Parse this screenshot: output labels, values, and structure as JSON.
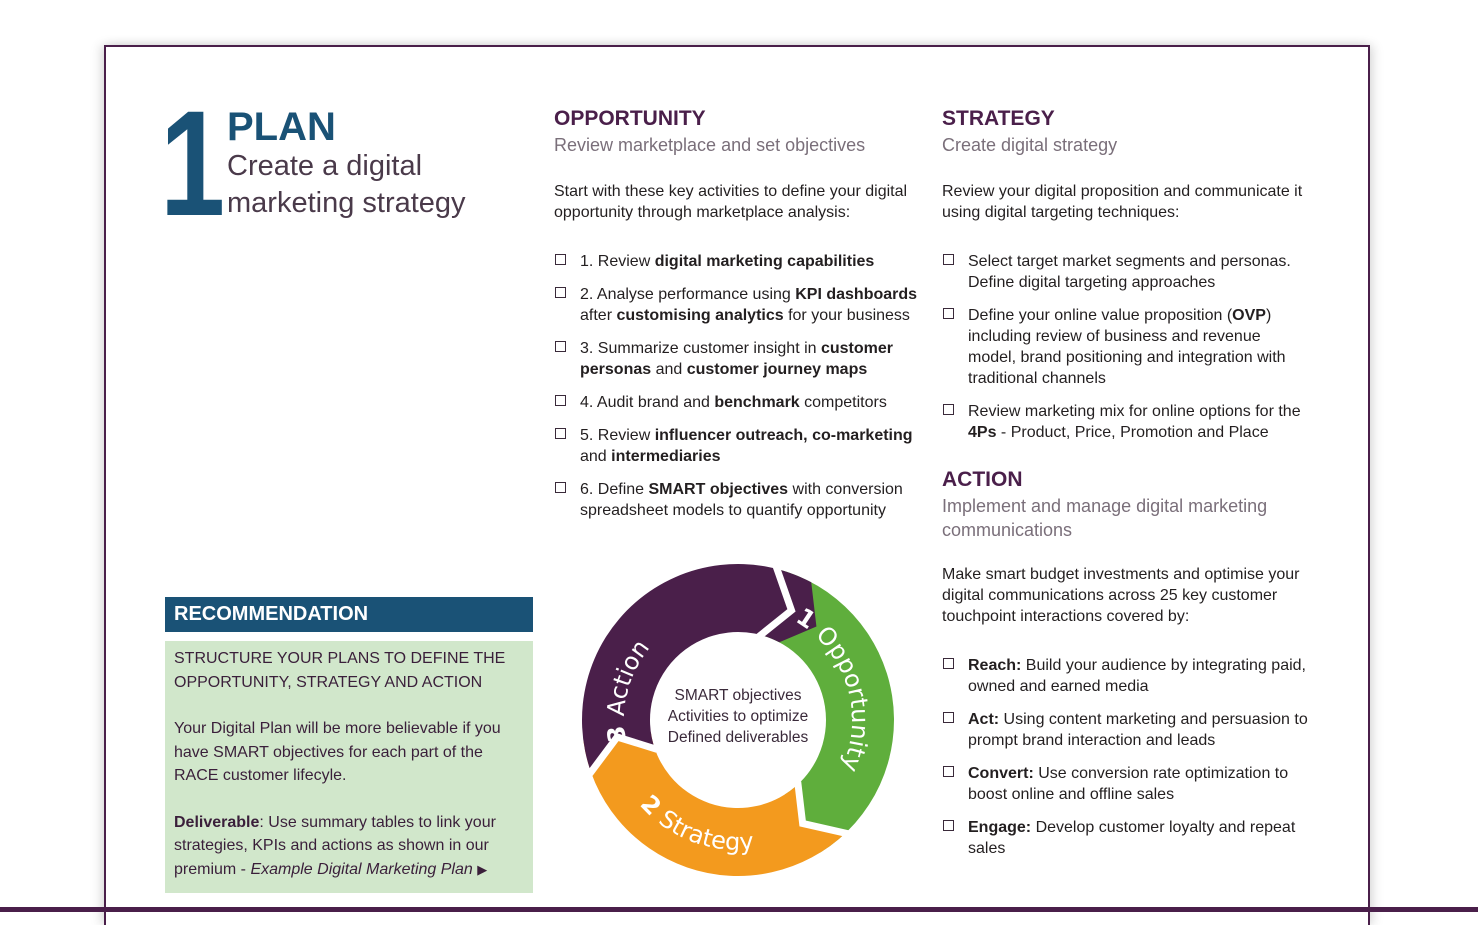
{
  "header": {
    "number": "1",
    "title": "PLAN",
    "subtitle": "Create a digital marketing strategy"
  },
  "opportunity": {
    "title": "OPPORTUNITY",
    "subtitle": "Review marketplace and set objectives",
    "intro": "Start with these key activities to define your digital opportunity through marketplace analysis:",
    "items": [
      [
        {
          "t": "1. Review "
        },
        {
          "t": "digital marketing capabilities",
          "b": true
        }
      ],
      [
        {
          "t": "2. Analyse performance using "
        },
        {
          "t": "KPI dashboards",
          "b": true
        },
        {
          "t": " after "
        },
        {
          "t": "customising analytics",
          "b": true
        },
        {
          "t": " for your business"
        }
      ],
      [
        {
          "t": "3. Summarize customer insight in "
        },
        {
          "t": "customer personas",
          "b": true
        },
        {
          "t": " and "
        },
        {
          "t": "customer journey maps",
          "b": true
        }
      ],
      [
        {
          "t": "4. Audit brand and "
        },
        {
          "t": "benchmark",
          "b": true
        },
        {
          "t": " competitors"
        }
      ],
      [
        {
          "t": "5. Review "
        },
        {
          "t": "influencer outreach, co-marketing",
          "b": true
        },
        {
          "t": " and "
        },
        {
          "t": "intermediaries",
          "b": true
        }
      ],
      [
        {
          "t": "6. Define "
        },
        {
          "t": "SMART objectives",
          "b": true
        },
        {
          "t": " with conversion spreadsheet models to quantify opportunity"
        }
      ]
    ]
  },
  "strategy": {
    "title": "STRATEGY",
    "subtitle": "Create digital strategy",
    "intro": "Review your digital proposition and communicate it using digital targeting techniques:",
    "items": [
      [
        {
          "t": "Select target market segments and personas. Define digital targeting approaches"
        }
      ],
      [
        {
          "t": "Define your online value proposition ("
        },
        {
          "t": "OVP",
          "b": true
        },
        {
          "t": ") including review of business and revenue model, brand positioning and integration with traditional channels"
        }
      ],
      [
        {
          "t": "Review marketing mix for online options for the "
        },
        {
          "t": "4Ps",
          "b": true
        },
        {
          "t": " - Product, Price, Promotion and Place"
        }
      ]
    ]
  },
  "action": {
    "title": "ACTION",
    "subtitle": "Implement and manage digital marketing communications",
    "intro": "Make smart budget investments and optimise your digital communications across 25 key customer touchpoint interactions covered by:",
    "items": [
      [
        {
          "t": "Reach:",
          "b": true
        },
        {
          "t": " Build your audience by integrating paid, owned and earned media"
        }
      ],
      [
        {
          "t": "Act:",
          "b": true
        },
        {
          "t": " Using content marketing and persuasion to prompt brand interaction and leads"
        }
      ],
      [
        {
          "t": "Convert:",
          "b": true
        },
        {
          "t": " Use conversion rate optimization to boost online and offline sales"
        }
      ],
      [
        {
          "t": "Engage:",
          "b": true
        },
        {
          "t": "  Develop customer loyalty and repeat sales"
        }
      ]
    ]
  },
  "recommendation": {
    "title": "RECOMMENDATION",
    "heading": "STRUCTURE YOUR PLANS TO DEFINE THE OPPORTUNITY, STRATEGY AND ACTION",
    "body": "Your Digital Plan will be more believable if you have SMART objectives for each part of the RACE customer lifecyle.",
    "deliverable_label": "Deliverable",
    "deliverable_text": ": Use summary tables to link your strategies, KPIs and actions as shown in our premium - ",
    "link_text": "Example Digital Marketing Plan",
    "link_icon": "play-arrow-icon"
  },
  "cycle": {
    "center_lines": [
      "SMART objectives",
      "Activities to optimize",
      "Defined deliverables"
    ],
    "segments": [
      {
        "num": "1",
        "label": "Opportunity",
        "color": "#5fae3c"
      },
      {
        "num": "2",
        "label": "Strategy",
        "color": "#f39a1e"
      },
      {
        "num": "3",
        "label": "Action",
        "color": "#4a1f4a"
      }
    ]
  },
  "colors": {
    "brand_blue": "#1a5276",
    "brand_purple": "#4a1f4a",
    "rec_green": "#d1e7cb"
  }
}
